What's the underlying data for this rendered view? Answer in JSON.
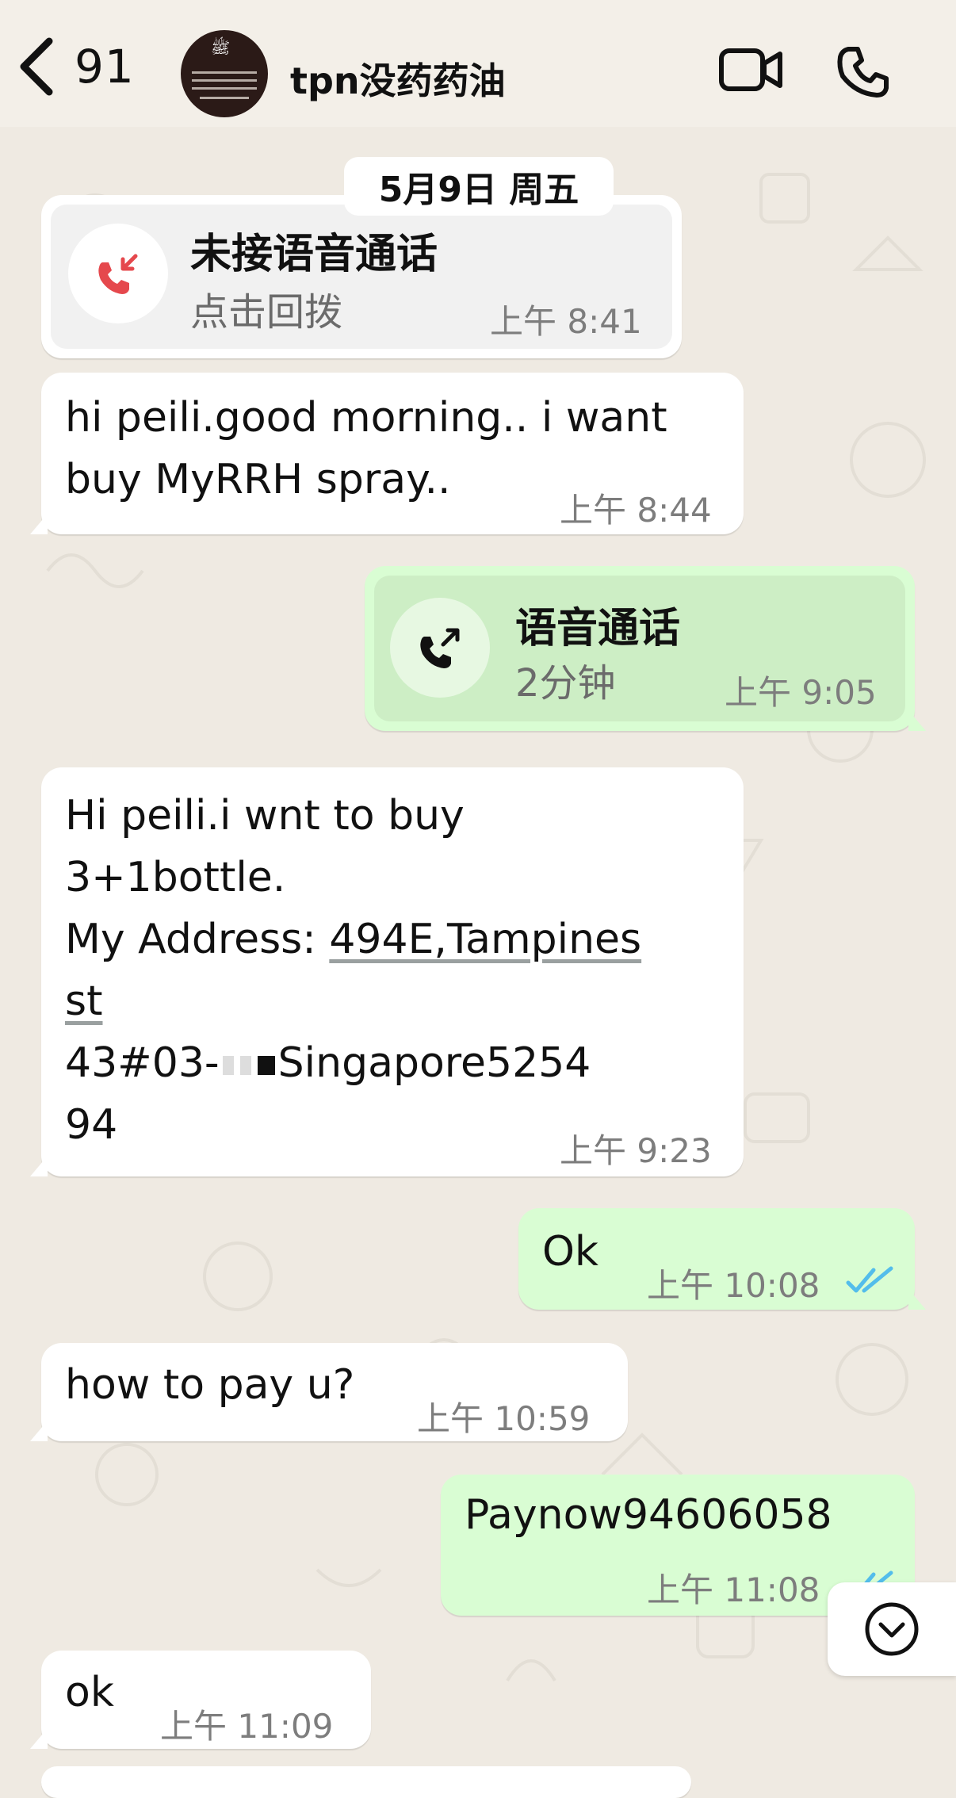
{
  "header": {
    "back_count": "91",
    "contact_name": "tpn没药药油",
    "avatar_logo": "ﷺ"
  },
  "date_label": "5月9日 周五",
  "messages": {
    "m1": {
      "title": "未接语音通话",
      "subtitle": "点击回拨",
      "time": "上午 8:41"
    },
    "m2": {
      "text": "hi peili.good morning.. i want\nbuy MyRRH spray..",
      "time": "上午 8:44"
    },
    "m3": {
      "title": "语音通话",
      "subtitle": "2分钟",
      "time": "上午 9:05"
    },
    "m4": {
      "line1": "Hi peili.i wnt to buy",
      "line2": "3+1bottle.",
      "line3a": "My Address: ",
      "line3b": "494E,Tampines",
      "line4": "st",
      "line5a": "43#03-",
      "line5b": "Singapore5254",
      "line6": "94",
      "time": "上午 9:23"
    },
    "m5": {
      "text": "Ok",
      "time": "上午 10:08"
    },
    "m6": {
      "text": "how to pay u?",
      "time": "上午 10:59"
    },
    "m7": {
      "text": "Paynow94606058",
      "time": "上午 11:08"
    },
    "m8": {
      "text": "ok",
      "time": "上午 11:09"
    }
  },
  "colors": {
    "incoming": "#ffffff",
    "outgoing": "#d9fdd3",
    "read_ticks": "#53bdeb",
    "missed_call": "#e5484d",
    "background": "#efeae2"
  }
}
